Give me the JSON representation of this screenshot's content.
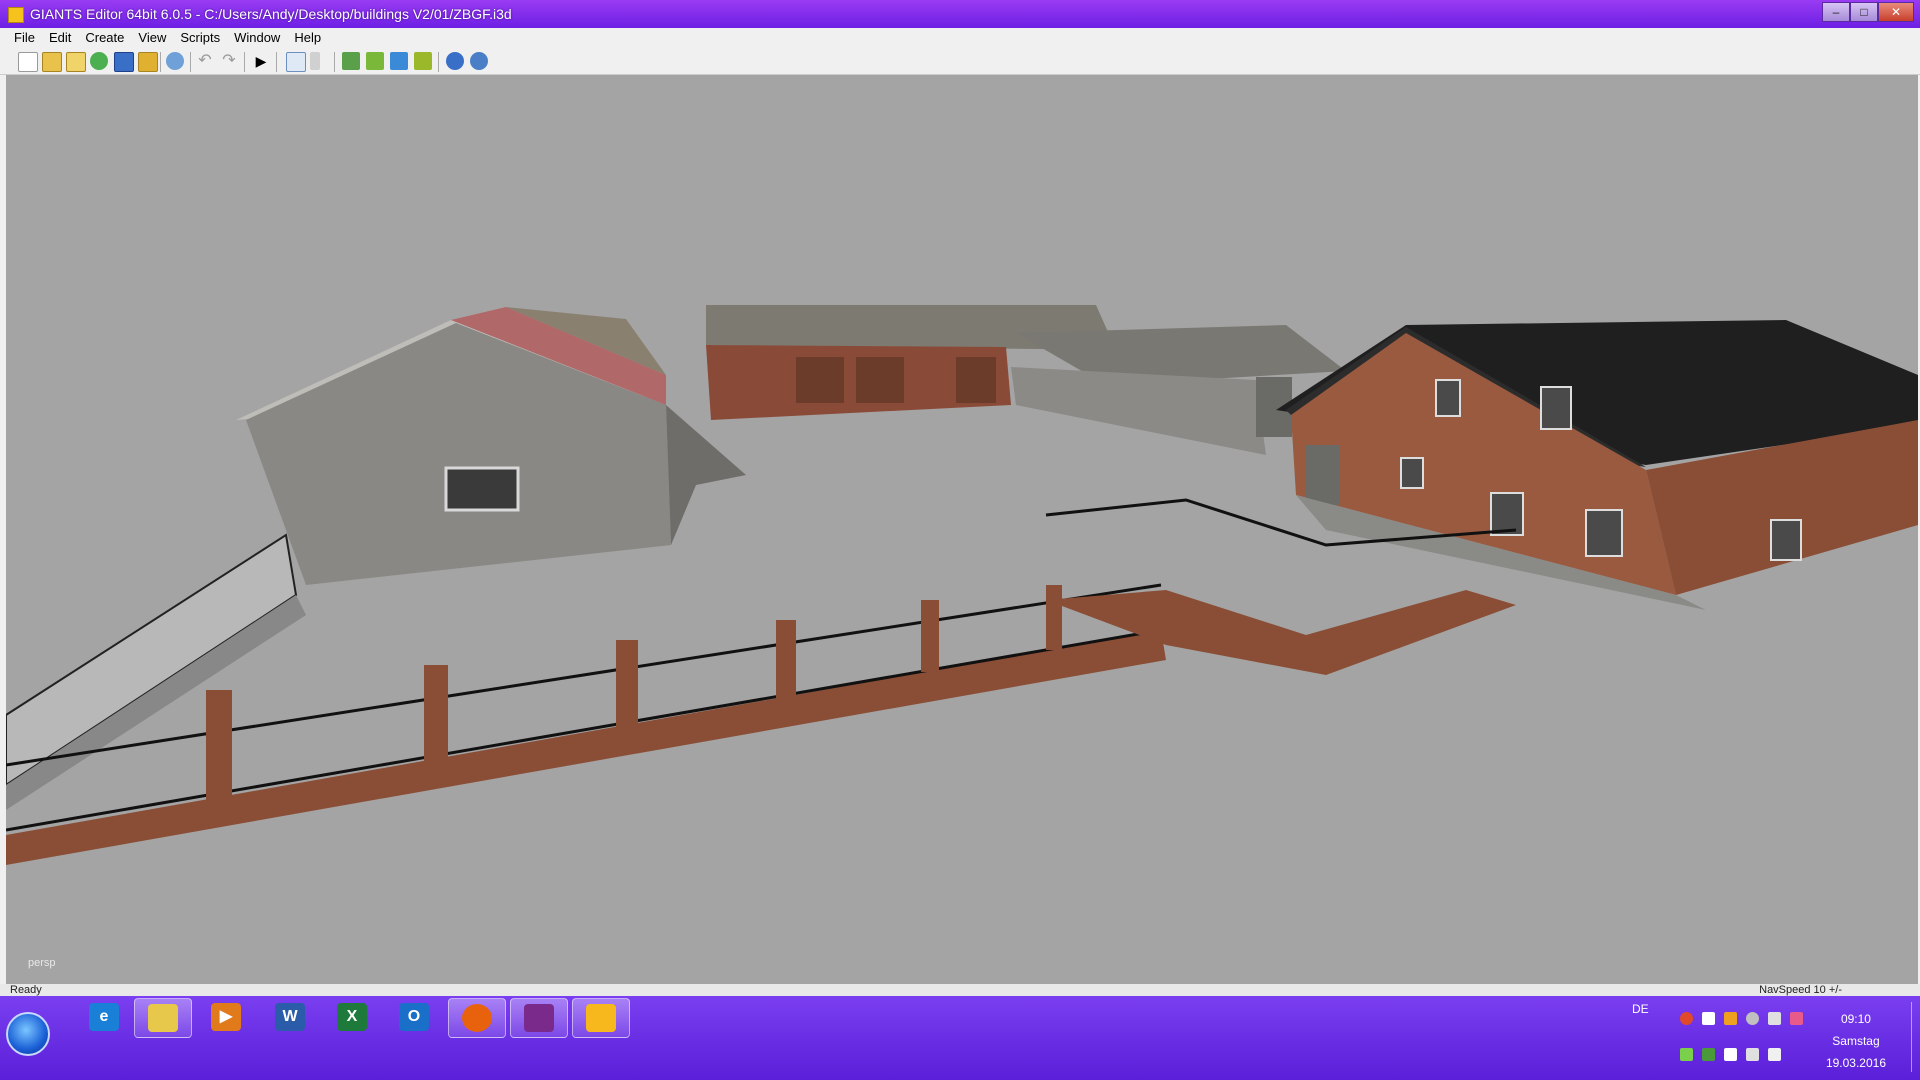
{
  "window": {
    "title": "GIANTS Editor 64bit 6.0.5 - C:/Users/Andy/Desktop/buildings V2/01/ZBGF.i3d"
  },
  "menu": [
    "File",
    "Edit",
    "Create",
    "View",
    "Scripts",
    "Window",
    "Help"
  ],
  "toolbar": {
    "tools": [
      "new-file-icon",
      "open-icon",
      "edit-icon",
      "refresh-icon",
      "save-icon",
      "export-icon",
      "reset-icon",
      "undo-icon",
      "redo-icon",
      "play-icon",
      "select-tool-icon",
      "move-tool-icon",
      "terrain-sculpt-icon",
      "terrain-paint-icon",
      "foliage-paint-icon",
      "placement-icon",
      "rotate-camera-icon",
      "settings-icon"
    ]
  },
  "viewport": {
    "camera_label": "persp",
    "background_color": "#a4a4a4"
  },
  "status": {
    "left": "Ready",
    "right": "NavSpeed 10 +/-"
  },
  "taskbar": {
    "apps": [
      {
        "name": "internet-explorer",
        "label": "e",
        "color": "#1a7fd6"
      },
      {
        "name": "file-explorer",
        "label": "",
        "color": "#e8c84a"
      },
      {
        "name": "media-player",
        "label": "▶",
        "color": "#e07a1a"
      },
      {
        "name": "word",
        "label": "W",
        "color": "#2a5caa"
      },
      {
        "name": "excel",
        "label": "X",
        "color": "#1e7a3a"
      },
      {
        "name": "outlook",
        "label": "O",
        "color": "#1a6fc8"
      },
      {
        "name": "firefox",
        "label": "",
        "color": "#e8620e"
      },
      {
        "name": "winrar",
        "label": "",
        "color": "#7a2a8a"
      },
      {
        "name": "giants-editor",
        "label": "",
        "color": "#f6b81c"
      }
    ],
    "language": "DE",
    "time": "09:10",
    "day": "Samstag",
    "date": "19.03.2016"
  }
}
